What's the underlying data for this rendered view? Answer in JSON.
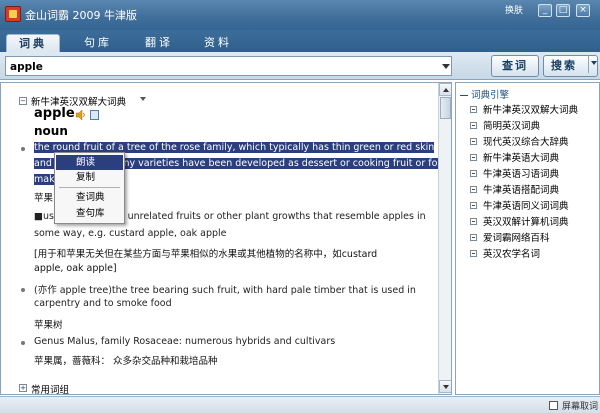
{
  "window": {
    "title": "金山词霸 2009 牛津版",
    "skin_label": "换肤",
    "minimize": "_",
    "maximize": "□",
    "close": "×"
  },
  "tabs": [
    "词典",
    "句库",
    "翻译",
    "资料"
  ],
  "search": {
    "value": "apple",
    "lookup_button": "查词",
    "search_button": "搜索"
  },
  "entry": {
    "dictionary": "新牛津英汉双解大词典",
    "headword": "apple",
    "pos": "noun",
    "definitions": [
      {
        "en_lines": [
          "the round fruit of a tree of the rose family, which typically has thin green or red skin",
          "and crisp flesh. Many varieties have been developed as dessert or cooking fruit or for",
          "making cider."
        ],
        "cn": "苹果"
      },
      {
        "en_lines": [
          "■used in names of unrelated fruits or other plant growths that resemble apples in",
          "some way, e.g. custard apple, oak apple"
        ],
        "cn_lines": [
          "[用于和苹果无关但在某些方面与苹果相似的水果或其他植物的名称中，如custard",
          "apple, oak apple]"
        ]
      },
      {
        "en_lines": [
          "(亦作 apple tree)the tree bearing such fruit, with hard pale timber that is used in",
          "carpentry and to smoke food"
        ],
        "cn": "苹果树"
      },
      {
        "en_lines": [
          "Genus Malus, family Rosaceae: numerous hybrids and cultivars"
        ],
        "cn": "苹果属，蔷薇科： 众多杂交品种和栽培品种"
      }
    ],
    "next_section": "常用词组"
  },
  "context_menu": {
    "items": [
      "朗读",
      "复制",
      "查词典",
      "查句库"
    ]
  },
  "sidebar": {
    "heading": "词典引擎",
    "items": [
      "新牛津英汉双解大词典",
      "简明英汉词典",
      "现代英汉综合大辞典",
      "新牛津英语大词典",
      "牛津英语习语词典",
      "牛津英语搭配词典",
      "牛津英语同义词词典",
      "英汉双解计算机词典",
      "爱词霸网络百科",
      "英汉农学名词"
    ]
  },
  "status": {
    "screen_lookup": "屏幕取词"
  },
  "colors": {
    "titlebar": "#3f6e99",
    "selection": "#2b3f80",
    "sidebar_heading": "#1b4f84"
  }
}
